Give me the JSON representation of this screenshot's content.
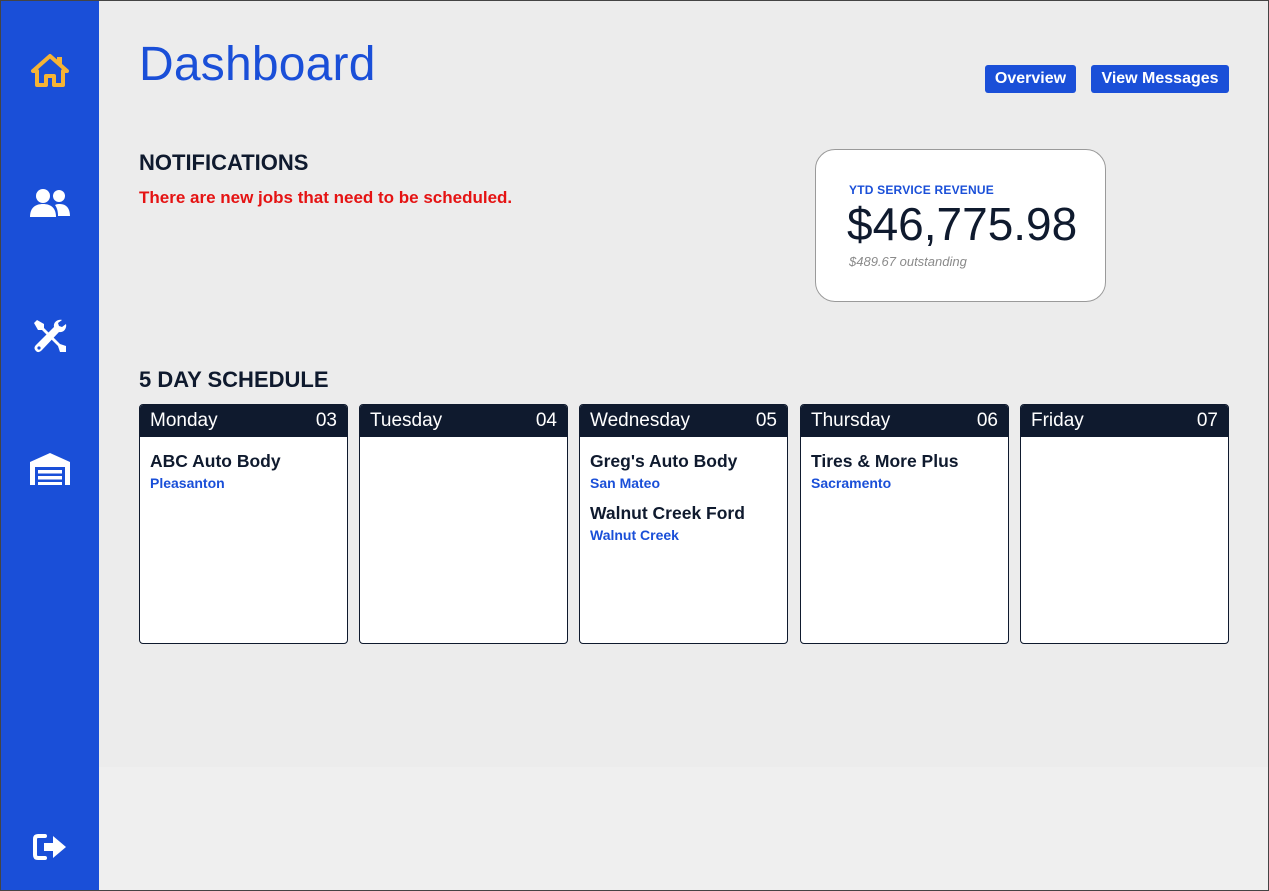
{
  "sidebar": {
    "items": [
      {
        "icon": "home-icon",
        "color": "#f5b335"
      },
      {
        "icon": "users-icon",
        "color": "#ffffff"
      },
      {
        "icon": "tools-icon",
        "color": "#ffffff"
      },
      {
        "icon": "garage-icon",
        "color": "#ffffff"
      },
      {
        "icon": "logout-icon",
        "color": "#ffffff"
      }
    ],
    "background": "#1a4fd8"
  },
  "header": {
    "title": "Dashboard",
    "overview_label": "Overview",
    "messages_label": "View Messages"
  },
  "notifications": {
    "title": "NOTIFICATIONS",
    "message": "There are new jobs that need to be scheduled."
  },
  "revenue": {
    "label": "YTD SERVICE REVENUE",
    "amount": "$46,775.98",
    "outstanding": "$489.67 outstanding"
  },
  "schedule": {
    "title": "5 DAY SCHEDULE",
    "days": [
      {
        "name": "Monday",
        "date": "03",
        "jobs": [
          {
            "name": "ABC Auto Body",
            "city": "Pleasanton"
          }
        ]
      },
      {
        "name": "Tuesday",
        "date": "04",
        "jobs": []
      },
      {
        "name": "Wednesday",
        "date": "05",
        "jobs": [
          {
            "name": "Greg's Auto Body",
            "city": "San Mateo"
          },
          {
            "name": "Walnut Creek Ford",
            "city": "Walnut Creek"
          }
        ]
      },
      {
        "name": "Thursday",
        "date": "06",
        "jobs": [
          {
            "name": "Tires & More Plus",
            "city": "Sacramento"
          }
        ]
      },
      {
        "name": "Friday",
        "date": "07",
        "jobs": []
      }
    ]
  },
  "colors": {
    "accent": "#1a4fd8",
    "dark": "#0f1a2e",
    "alert": "#e51313"
  }
}
